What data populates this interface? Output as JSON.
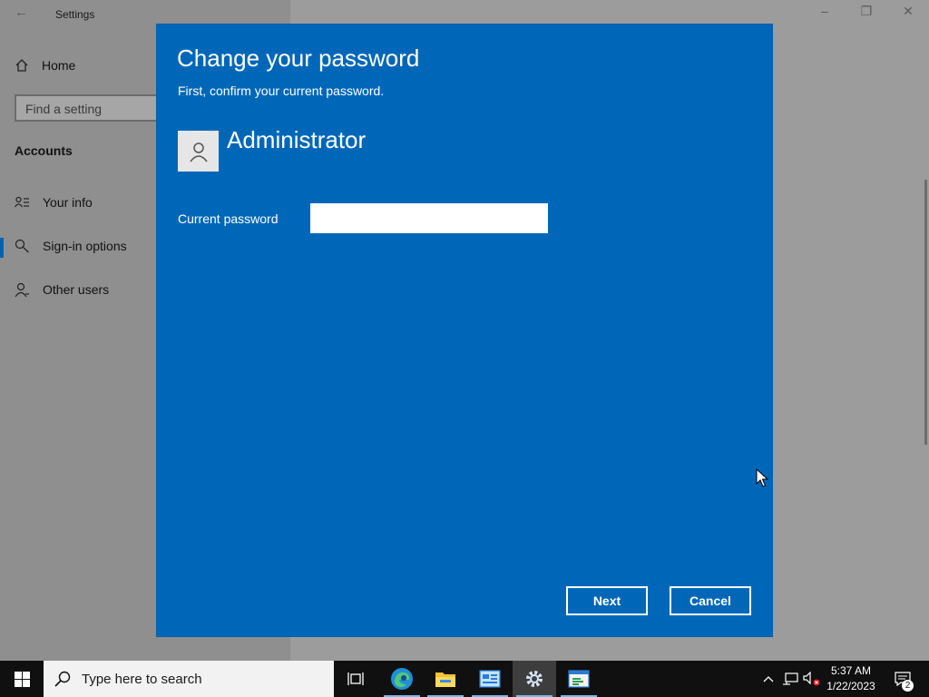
{
  "settings_window": {
    "title": "Settings",
    "nav": {
      "home_label": "Home",
      "search_placeholder": "Find a setting",
      "section_title": "Accounts",
      "items": [
        {
          "label": "Your info",
          "icon": "contact-card-icon"
        },
        {
          "label": "Sign-in options",
          "icon": "key-icon",
          "selected": true
        },
        {
          "label": "Other users",
          "icon": "person-icon"
        }
      ]
    }
  },
  "dialog": {
    "title": "Change your password",
    "subtitle": "First, confirm your current password.",
    "username": "Administrator",
    "password_label": "Current password",
    "password_value": "",
    "next_label": "Next",
    "cancel_label": "Cancel",
    "background_color": "#0067b8"
  },
  "taskbar": {
    "search_placeholder": "Type here to search",
    "apps": [
      "task-view-icon",
      "edge-icon",
      "file-explorer-icon",
      "control-panel-icon",
      "settings-icon",
      "server-manager-icon"
    ],
    "active_app": "settings-icon",
    "clock_time": "5:37 AM",
    "clock_date": "1/22/2023",
    "notification_count": "2"
  }
}
